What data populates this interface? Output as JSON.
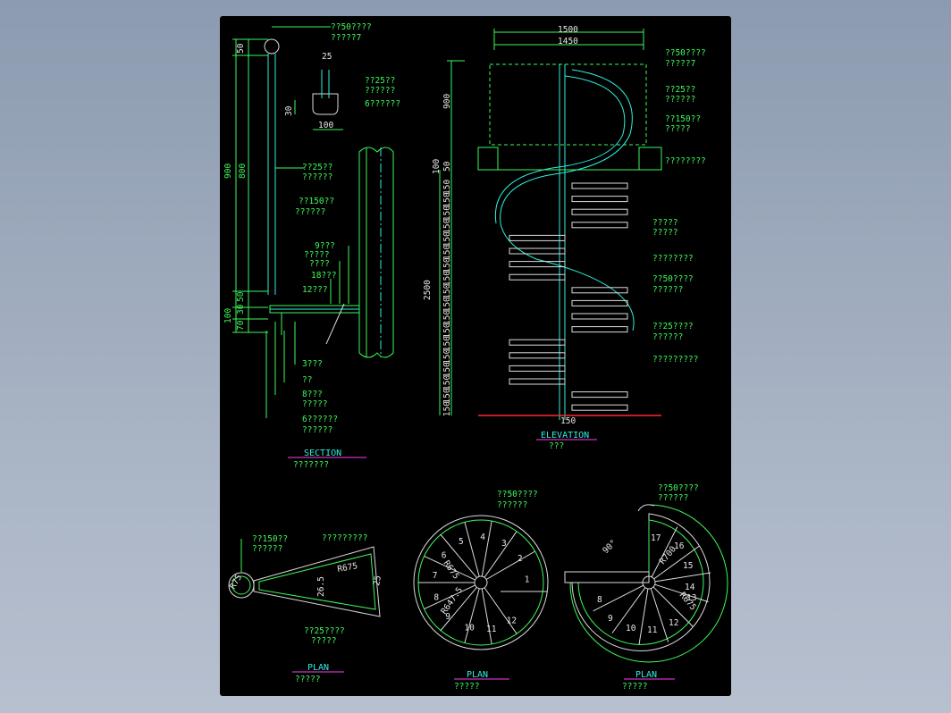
{
  "section": {
    "callouts": [
      "??50????",
      "?????7",
      "??25??",
      "??????",
      "6??????",
      "??25??",
      "??????",
      "??150??",
      "??????",
      "9???",
      "?????",
      "????",
      "18???",
      "12???",
      "3???",
      "??",
      "8???",
      "?????",
      "6??????",
      "??????"
    ],
    "dims": [
      "25",
      "30",
      "100",
      "50",
      "900",
      "800",
      "50",
      "100",
      "30",
      "70"
    ],
    "title": "SECTION",
    "subtitle": "???????"
  },
  "elevation": {
    "top_dims": [
      "1500",
      "1450"
    ],
    "left_dims": [
      "900",
      "50",
      "100",
      "2500"
    ],
    "rise_labels": [
      "150",
      "150",
      "150",
      "150",
      "150",
      "150",
      "150",
      "150",
      "150",
      "150",
      "150",
      "150",
      "150",
      "150",
      "150",
      "150",
      "150",
      "150"
    ],
    "bottom_dim": "150",
    "callouts": [
      "??50????",
      "?????7",
      "??25??",
      "??????",
      "??150??",
      "?????",
      "????????",
      "?????",
      "?????",
      "????????",
      "??50????",
      "??????",
      "??25????",
      "??????",
      "?????????"
    ],
    "title": "ELEVATION",
    "subtitle": "???"
  },
  "plan_tread": {
    "callouts": [
      "??150??",
      "??????",
      "?????????",
      "??25????",
      "?????"
    ],
    "dims": [
      "R75",
      "R675",
      "26.5",
      "25"
    ],
    "title": "PLAN",
    "subtitle": "?????"
  },
  "plan_circle": {
    "callouts": [
      "??50????",
      "??????"
    ],
    "step_numbers": [
      "1",
      "2",
      "3",
      "4",
      "5",
      "6",
      "7",
      "8",
      "9",
      "10",
      "11",
      "12"
    ],
    "radius_labels": [
      "R675",
      "R647.5"
    ],
    "title": "PLAN",
    "subtitle": "?????"
  },
  "plan_landing": {
    "callouts": [
      "??50????",
      "??????"
    ],
    "step_numbers": [
      "8",
      "9",
      "10",
      "11",
      "12",
      "13",
      "14",
      "15",
      "16",
      "17"
    ],
    "angle": "90°",
    "radius_labels": [
      "R700",
      "R675"
    ],
    "title": "PLAN",
    "subtitle": "?????"
  }
}
